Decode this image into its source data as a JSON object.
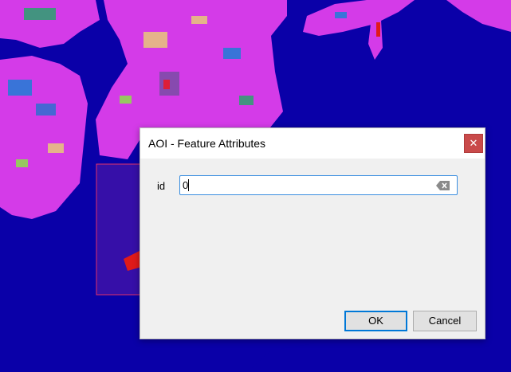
{
  "dialog": {
    "title": "AOI - Feature Attributes",
    "close_symbol": "✕",
    "field": {
      "label": "id",
      "value": "0"
    },
    "ok_label": "OK",
    "cancel_label": "Cancel"
  },
  "icons": {
    "close": "close-icon",
    "clear": "clear-field-icon"
  },
  "colors": {
    "water": "#0a00a8",
    "land": "#d43be8",
    "close_button": "#c94a4a",
    "focus": "#3a8ee0"
  }
}
